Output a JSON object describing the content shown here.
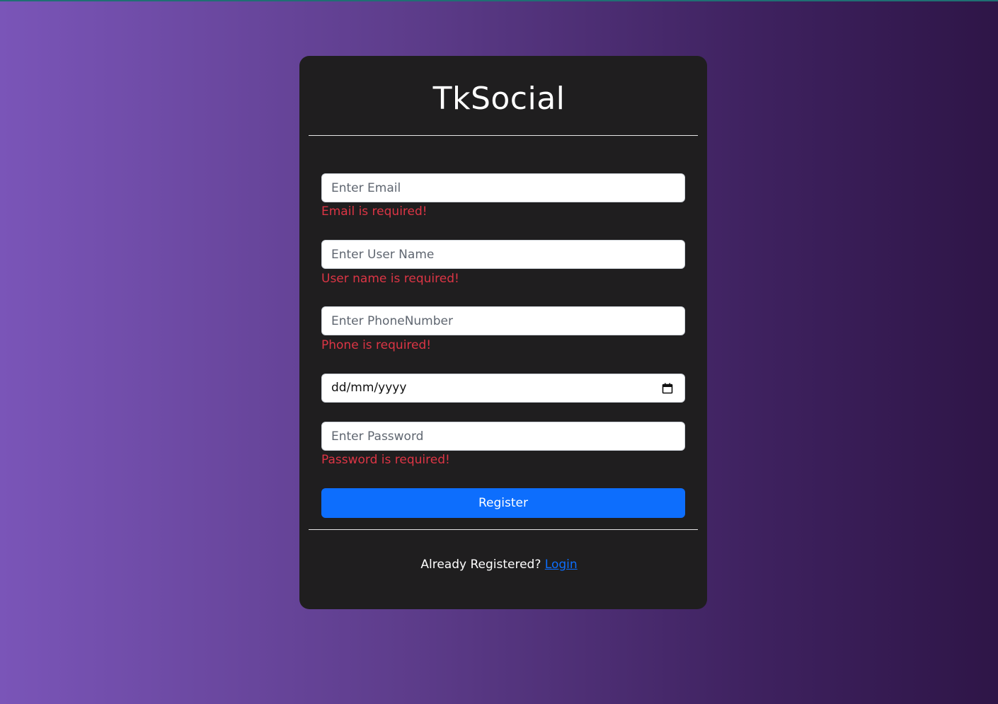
{
  "app": {
    "title": "TkSocial"
  },
  "form": {
    "email": {
      "placeholder": "Enter Email",
      "value": "",
      "error": "Email is required!"
    },
    "username": {
      "placeholder": "Enter User Name",
      "value": "",
      "error": "User name is required!"
    },
    "phone": {
      "placeholder": "Enter PhoneNumber",
      "value": "",
      "error": "Phone is required!"
    },
    "birthdate": {
      "display": "dd/mm/yyyy"
    },
    "password": {
      "placeholder": "Enter Password",
      "value": "",
      "error": "Password is required!"
    },
    "register_label": "Register"
  },
  "footer": {
    "prompt": "Already Registered?",
    "login_label": "Login"
  },
  "icons": {
    "date_picker": "calendar-icon"
  },
  "colors": {
    "accent": "#0d6efd",
    "error": "#dc3545",
    "card_background": "#1f1e1f"
  }
}
